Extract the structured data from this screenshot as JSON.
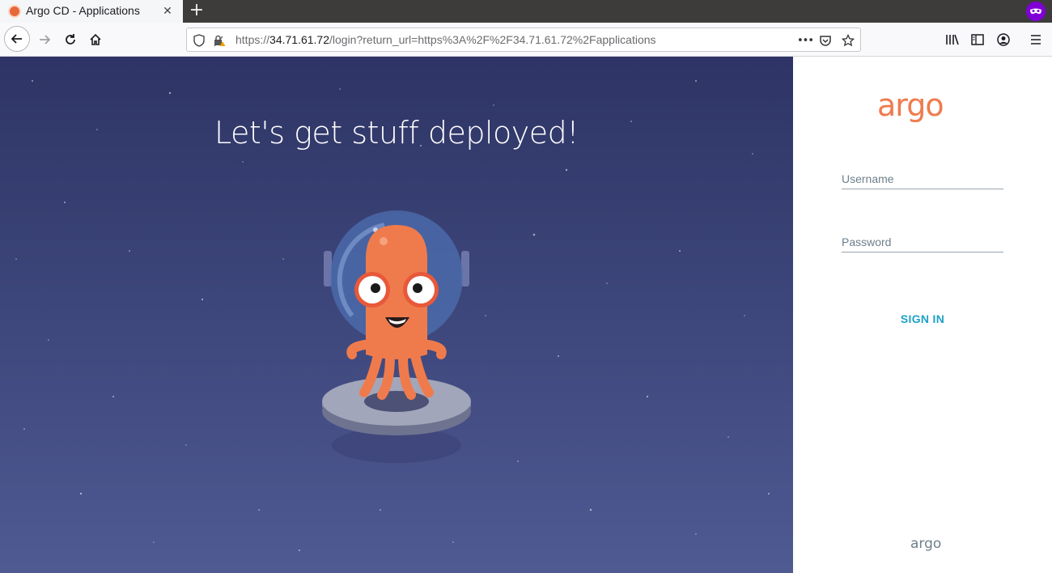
{
  "browser": {
    "tab_title": "Argo CD - Applications",
    "tab_close_glyph": "✕",
    "new_tab_glyph": "+",
    "url_scheme": "https://",
    "url_host": "34.71.61.72",
    "url_path": "/login?return_url=https%3A%2F%2F34.71.61.72%2Fapplications",
    "page_actions_glyph": "•••",
    "icons": [
      "back-arrow-icon",
      "forward-arrow-icon",
      "reload-icon",
      "home-icon",
      "shield-icon",
      "insecure-lock-icon",
      "pocket-icon",
      "bookmark-star-icon",
      "library-icon",
      "sidebar-icon",
      "account-icon",
      "menu-icon",
      "private-browsing-icon"
    ]
  },
  "hero": {
    "title": "Let's get stuff deployed!"
  },
  "login": {
    "logo_text": "argo",
    "username_placeholder": "Username",
    "password_placeholder": "Password",
    "signin_label": "SIGN IN",
    "footer_logo_text": "argo"
  },
  "colors": {
    "accent_orange": "#ef7b4d",
    "signin_blue": "#1ea0c8",
    "hero_top": "#2e3465",
    "hero_bottom": "#4f5a93",
    "private_purple": "#8000d7"
  }
}
